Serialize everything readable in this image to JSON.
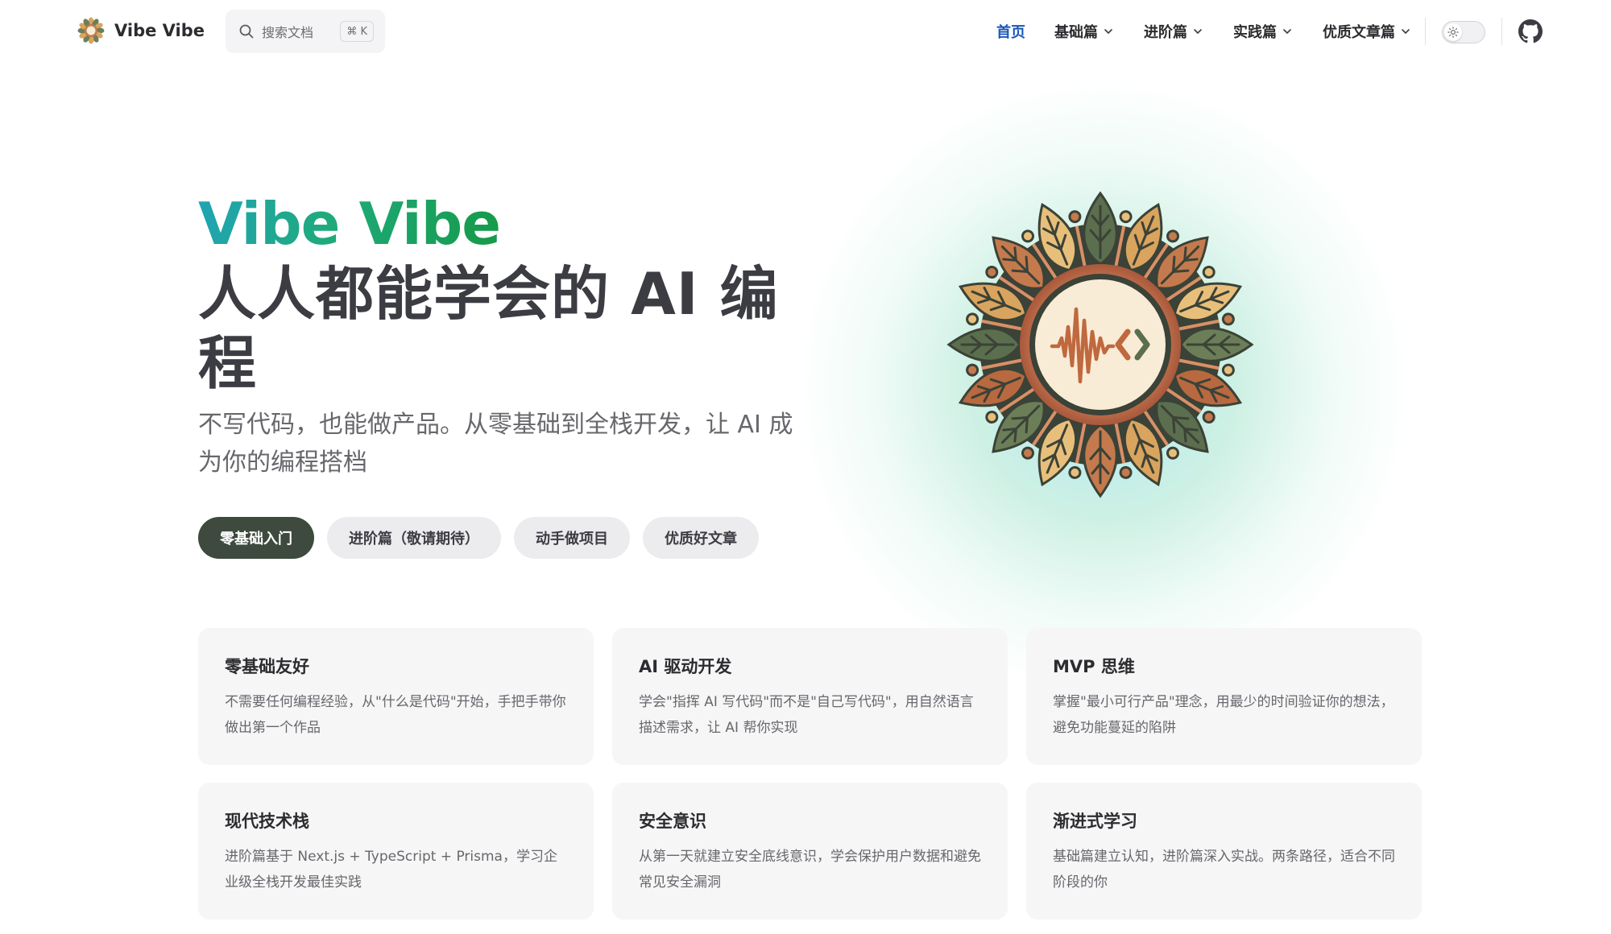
{
  "colors": {
    "brand_green": "#3d4a3d",
    "active_link": "#1a56b8",
    "name_gradient_start": "#20a4b4",
    "name_gradient_end": "#159a48",
    "card_background": "#f6f6f7"
  },
  "nav": {
    "logo_icon": "mandala-logo-icon",
    "site_title": "Vibe Vibe",
    "search": {
      "icon": "search-icon",
      "placeholder": "搜索文档",
      "shortcut": "⌘ K"
    },
    "links": [
      {
        "label": "首页",
        "active": true,
        "dropdown": false
      },
      {
        "label": "基础篇",
        "active": false,
        "dropdown": true
      },
      {
        "label": "进阶篇",
        "active": false,
        "dropdown": true
      },
      {
        "label": "实践篇",
        "active": false,
        "dropdown": true
      },
      {
        "label": "优质文章篇",
        "active": false,
        "dropdown": true
      }
    ],
    "theme_toggle_icon": "sun-icon",
    "github_icon": "github-icon"
  },
  "hero": {
    "name": "Vibe Vibe",
    "tagline": "人人都能学会的 AI 编程",
    "description": "不写代码，也能做产品。从零基础到全栈开发，让 AI 成为你的编程搭档",
    "image_icon": "mandala-emblem-icon",
    "actions": [
      {
        "label": "零基础入门",
        "theme": "brand"
      },
      {
        "label": "进阶篇（敬请期待）",
        "theme": "alt"
      },
      {
        "label": "动手做项目",
        "theme": "alt"
      },
      {
        "label": "优质好文章",
        "theme": "alt"
      }
    ]
  },
  "features": [
    {
      "title": "零基础友好",
      "details": "不需要任何编程经验，从\"什么是代码\"开始，手把手带你做出第一个作品"
    },
    {
      "title": "AI 驱动开发",
      "details": "学会\"指挥 AI 写代码\"而不是\"自己写代码\"，用自然语言描述需求，让 AI 帮你实现"
    },
    {
      "title": "MVP 思维",
      "details": "掌握\"最小可行产品\"理念，用最少的时间验证你的想法，避免功能蔓延的陷阱"
    },
    {
      "title": "现代技术栈",
      "details": "进阶篇基于 Next.js + TypeScript + Prisma，学习企业级全栈开发最佳实践"
    },
    {
      "title": "安全意识",
      "details": "从第一天就建立安全底线意识，学会保护用户数据和避免常见安全漏洞"
    },
    {
      "title": "渐进式学习",
      "details": "基础篇建立认知，进阶篇深入实战。两条路径，适合不同阶段的你"
    }
  ]
}
